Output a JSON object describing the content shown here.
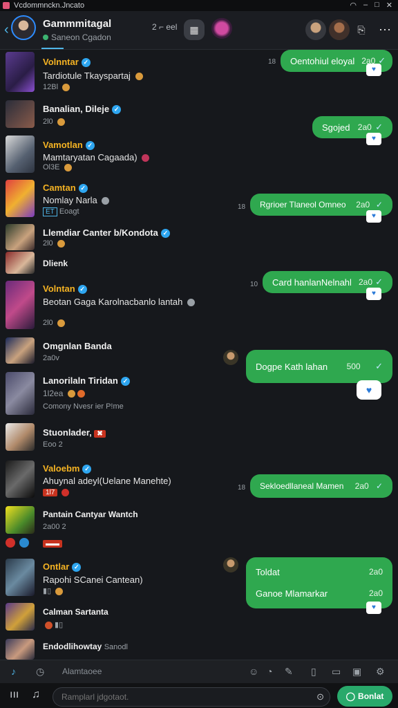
{
  "statusbar": {
    "title": "Vcdommnckn.Jncato"
  },
  "header": {
    "channel_name": "Gammmitagal",
    "subtitle": "Saneon Cgadon",
    "pill": "2 ⌐ eel"
  },
  "messages": [
    {
      "name": "Volnntar",
      "verified": true,
      "text": "Tardiotule Tkayspartaj",
      "meta": "12Bl"
    },
    {
      "name": "Banalian, Dileje",
      "verified": true,
      "text": "",
      "meta": "2l0"
    },
    {
      "name": "Vamotlan",
      "verified": true,
      "text": "Mamtaryatan Cagaada)",
      "meta": "Ol3E"
    },
    {
      "name": "Camtan",
      "verified": true,
      "text": "Nomlay Narla",
      "meta": "Eoagt"
    },
    {
      "name": "Llemdiar Canter b/Kondota",
      "verified": true,
      "text": "",
      "meta": "2l0"
    },
    {
      "name": "Dlienk",
      "verified": false,
      "text": "",
      "meta": ""
    },
    {
      "name": "Volntan",
      "verified": true,
      "text": "Beotan Gaga Karolnacbanlo lantah",
      "meta": "2l0"
    },
    {
      "name": "Omgnlan Banda",
      "verified": false,
      "text": "",
      "meta": "2a0v"
    },
    {
      "name": "Lanorilaln Tiridan",
      "verified": true,
      "text": "1l2ea",
      "meta": "Comony Nvesr ier P!me"
    },
    {
      "name": "Stuonlader,",
      "verified": false,
      "text": "",
      "meta": "Eoo 2"
    },
    {
      "name": "Valoebm",
      "verified": true,
      "text": "Ahuynal adeyl(Uelane Manehte)",
      "meta": "1l7"
    },
    {
      "name": "Pantain Cantyar Wantch",
      "verified": false,
      "text": "",
      "meta": "2a00 2"
    },
    {
      "name": "Ontlar",
      "verified": true,
      "text": "Rapohi SCanei Cantean)",
      "meta": ""
    },
    {
      "name": "Calman Sartanta",
      "verified": false,
      "text": "",
      "meta": ""
    },
    {
      "name": "Endodlihowtay",
      "verified": false,
      "text": "Sanodl",
      "meta": ""
    }
  ],
  "bubbles": [
    {
      "text": "Oentohiul eloyal",
      "time": "2a0",
      "side_time": "18"
    },
    {
      "text": "Sgojed",
      "time": "2a0",
      "side_time": ""
    },
    {
      "text": "Rgrioer Tlaneol Omneo",
      "time": "2a0",
      "side_time": "18"
    },
    {
      "text": "Card hanlanNelnahl",
      "time": "2a0",
      "side_time": "10"
    },
    {
      "text": "Dogpe Kath lahan",
      "time": "500",
      "side_time": ""
    },
    {
      "text": "Sekloedllaneal Mamen",
      "time": "2a0",
      "side_time": "18"
    },
    {
      "text": "Toldat",
      "time": "2a0",
      "side_time": ""
    },
    {
      "text": "Ganoe Mlamarkar",
      "time": "2a0",
      "side_time": ""
    }
  ],
  "toolbar": {
    "field": "Alamtaoee"
  },
  "input": {
    "placeholder": "Ramplarl jdgotaot.",
    "send_label": "Bonlat"
  },
  "colors": {
    "accent": "#2fa84f",
    "background": "#16181c",
    "link": "#4fb6e8",
    "gold": "#f5b323"
  }
}
